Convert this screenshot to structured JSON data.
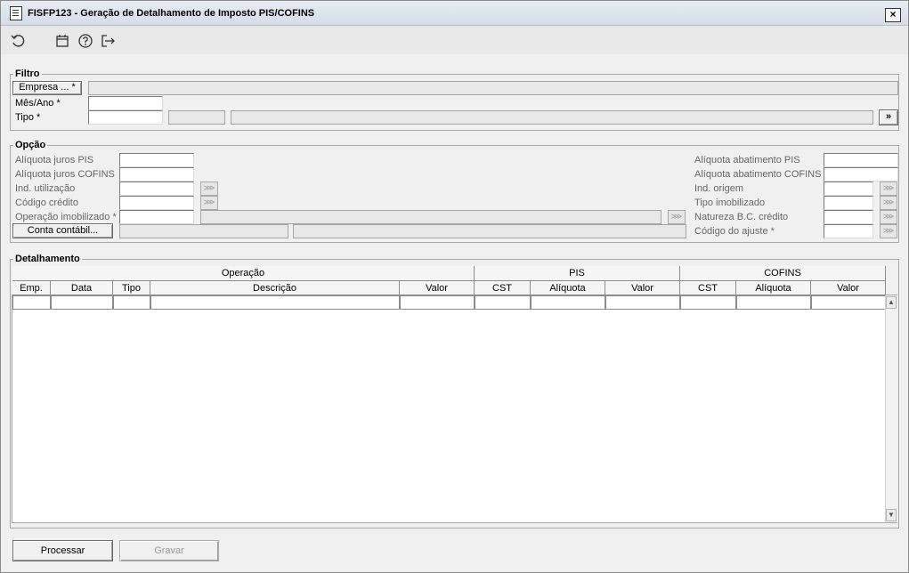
{
  "window": {
    "title": "FISFP123 - Geração de Detalhamento de Imposto PIS/COFINS",
    "close": "×"
  },
  "toolbar": {
    "icons": [
      "undo-icon",
      "calendar-icon",
      "help-icon",
      "exit-icon"
    ]
  },
  "filtro": {
    "title": "Filtro",
    "empresa_button": "Empresa ... *",
    "mes_ano_label": "Mês/Ano *",
    "tipo_label": "Tipo *",
    "tipo_more": "»"
  },
  "opcao": {
    "title": "Opção",
    "left_labels": [
      "Alíquota juros PIS",
      "Alíquota juros COFINS",
      "Ind. utilização",
      "Código crédito",
      "Operação imobilizado *"
    ],
    "conta_button": "Conta contábil...",
    "right_labels": [
      "Alíquota abatimento PIS",
      "Alíquota abatimento COFINS",
      "Ind. origem",
      "Tipo imobilizado",
      "Natureza B.C. crédito",
      "Código do ajuste *"
    ]
  },
  "detalhamento": {
    "title": "Detalhamento",
    "groups": [
      "Operação",
      "PIS",
      "COFINS"
    ],
    "columns": [
      "Emp.",
      "Data",
      "Tipo",
      "Descrição",
      "Valor",
      "CST",
      "Alíquota",
      "Valor",
      "CST",
      "Alíquota",
      "Valor"
    ]
  },
  "footer": {
    "processar": "Processar",
    "gravar": "Gravar"
  }
}
